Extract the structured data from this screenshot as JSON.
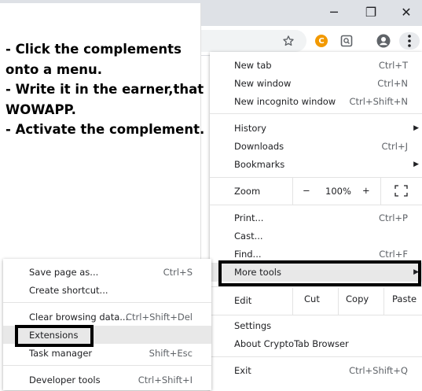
{
  "instructions": [
    "- Click the complements",
    "onto a menu.",
    "- Write it in the earner,that",
    "WOWAPP.",
    "- Activate the complement."
  ],
  "window_controls": {
    "minimize": "─",
    "restore": "❐",
    "close": "✕"
  },
  "toolbar": {
    "extension_badge": "C"
  },
  "main_menu": {
    "new_tab": {
      "label": "New tab",
      "shortcut": "Ctrl+T"
    },
    "new_window": {
      "label": "New window",
      "shortcut": "Ctrl+N"
    },
    "new_incognito": {
      "label": "New incognito window",
      "shortcut": "Ctrl+Shift+N"
    },
    "history": {
      "label": "History"
    },
    "downloads": {
      "label": "Downloads",
      "shortcut": "Ctrl+J"
    },
    "bookmarks": {
      "label": "Bookmarks"
    },
    "zoom": {
      "label": "Zoom",
      "minus": "−",
      "value": "100%",
      "plus": "+"
    },
    "print": {
      "label": "Print...",
      "shortcut": "Ctrl+P"
    },
    "cast": {
      "label": "Cast..."
    },
    "find": {
      "label": "Find...",
      "shortcut": "Ctrl+F"
    },
    "more_tools": {
      "label": "More tools"
    },
    "edit": {
      "label": "Edit",
      "cut": "Cut",
      "copy": "Copy",
      "paste": "Paste"
    },
    "settings": {
      "label": "Settings"
    },
    "about": {
      "label": "About CryptoTab Browser"
    },
    "exit": {
      "label": "Exit",
      "shortcut": "Ctrl+Shift+Q"
    }
  },
  "submenu": {
    "save_page": {
      "label": "Save page as...",
      "shortcut": "Ctrl+S"
    },
    "create_shortcut": {
      "label": "Create shortcut..."
    },
    "clear_data": {
      "label": "Clear browsing data...",
      "shortcut": "Ctrl+Shift+Del"
    },
    "extensions": {
      "label": "Extensions"
    },
    "task_manager": {
      "label": "Task manager",
      "shortcut": "Shift+Esc"
    },
    "developer_tools": {
      "label": "Developer tools",
      "shortcut": "Ctrl+Shift+I"
    }
  }
}
